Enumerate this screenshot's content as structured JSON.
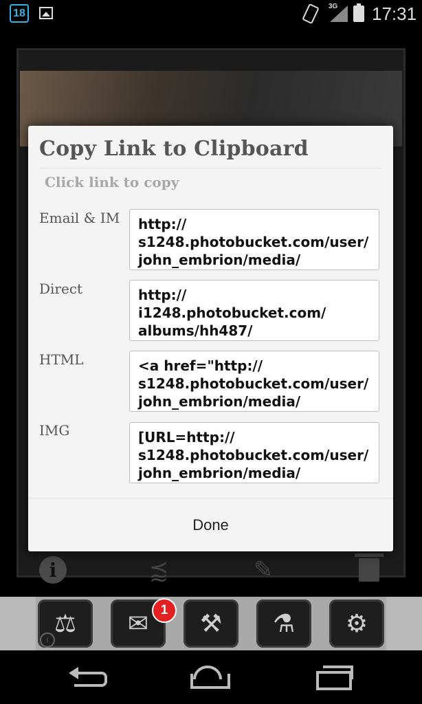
{
  "status_bar": {
    "calendar_day": "18",
    "network": "3G",
    "time": "17:31",
    "icons": [
      "calendar-icon",
      "image-icon",
      "vibrate-icon",
      "signal-icon",
      "battery-icon"
    ]
  },
  "dialog": {
    "title": "Copy Link to Clipboard",
    "subtitle": "Click link to copy",
    "links": [
      {
        "label": "Email & IM",
        "value": "http://\ns1248.photobucket.com/user/\njohn_embrion/media/"
      },
      {
        "label": "Direct",
        "value": "http://\ni1248.photobucket.com/\nalbums/hh487/"
      },
      {
        "label": "HTML",
        "value": "<a href=\"http://\ns1248.photobucket.com/user/\njohn_embrion/media/"
      },
      {
        "label": "IMG",
        "value": "[URL=http://\ns1248.photobucket.com/user/\njohn_embrion/media/"
      }
    ],
    "done_label": "Done"
  },
  "actions": [
    "info-icon",
    "share-icon",
    "edit-icon",
    "trash-icon"
  ],
  "toolbar": {
    "buttons": [
      "scale-icon",
      "mail-icon",
      "tools-icon",
      "flask-icon",
      "settings-icon"
    ],
    "mail_badge": "1"
  },
  "nav": [
    "back-icon",
    "home-icon",
    "recent-apps-icon"
  ]
}
